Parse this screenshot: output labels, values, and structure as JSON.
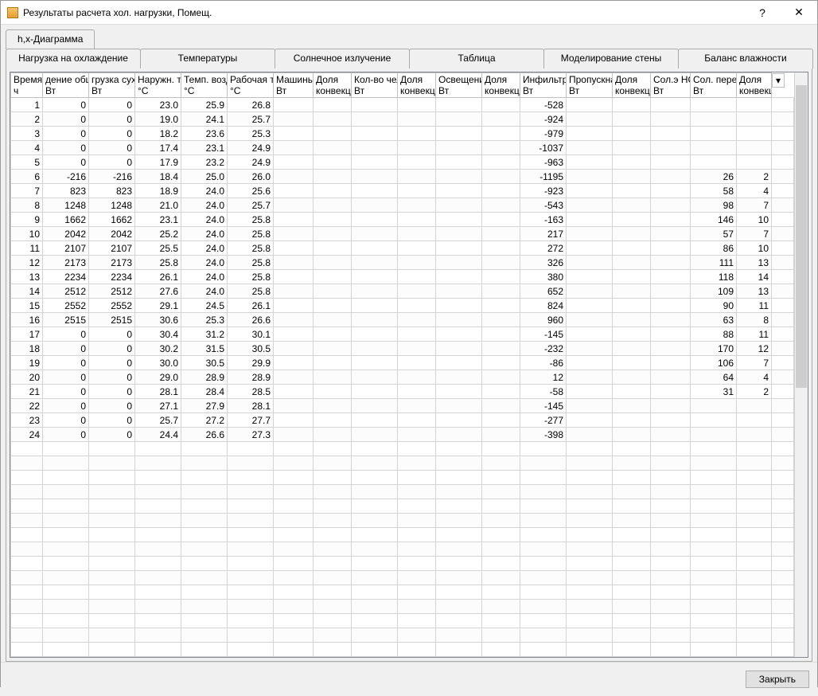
{
  "title": "Результаты расчета хол. нагрузки, Помещ.",
  "help": "?",
  "close": "✕",
  "tab_diagram": "h,x-Диаграмма",
  "tabs": [
    "Нагрузка на охлаждение",
    "Температуры",
    "Солнечное излучение",
    "Таблица",
    "Моделирование стены",
    "Баланс влажности"
  ],
  "columns": [
    {
      "h1": "Время",
      "h2": "ч"
    },
    {
      "h1": "дение общ.",
      "h2": "Вт"
    },
    {
      "h1": "грузка сух.",
      "h2": "Вт"
    },
    {
      "h1": "Наружн. те",
      "h2": "°C"
    },
    {
      "h1": "Темп. возд",
      "h2": "°C"
    },
    {
      "h1": "Рабочая те",
      "h2": "°C"
    },
    {
      "h1": "Машины",
      "h2": "Вт"
    },
    {
      "h1": "Доля",
      "h2": "конвекц"
    },
    {
      "h1": "Кол-во чел.",
      "h2": "Вт"
    },
    {
      "h1": "Доля",
      "h2": "конвекц"
    },
    {
      "h1": "Освещение",
      "h2": "Вт"
    },
    {
      "h1": "Доля",
      "h2": "конвекц"
    },
    {
      "h1": "Инфильтра",
      "h2": "Вт"
    },
    {
      "h1": "Пропускна",
      "h2": "Вт"
    },
    {
      "h1": "Доля",
      "h2": "конвекц"
    },
    {
      "h1": "Сол.э НС",
      "h2": "Вт"
    },
    {
      "h1": "Сол. перед",
      "h2": "Вт"
    },
    {
      "h1": "Доля",
      "h2": "конвекц"
    }
  ],
  "rows": [
    [
      "1",
      "0",
      "0",
      "23.0",
      "25.9",
      "26.8",
      "",
      "",
      "",
      "",
      "",
      "",
      "-528",
      "",
      "",
      "",
      "",
      ""
    ],
    [
      "2",
      "0",
      "0",
      "19.0",
      "24.1",
      "25.7",
      "",
      "",
      "",
      "",
      "",
      "",
      "-924",
      "",
      "",
      "",
      "",
      ""
    ],
    [
      "3",
      "0",
      "0",
      "18.2",
      "23.6",
      "25.3",
      "",
      "",
      "",
      "",
      "",
      "",
      "-979",
      "",
      "",
      "",
      "",
      ""
    ],
    [
      "4",
      "0",
      "0",
      "17.4",
      "23.1",
      "24.9",
      "",
      "",
      "",
      "",
      "",
      "",
      "-1037",
      "",
      "",
      "",
      "",
      ""
    ],
    [
      "5",
      "0",
      "0",
      "17.9",
      "23.2",
      "24.9",
      "",
      "",
      "",
      "",
      "",
      "",
      "-963",
      "",
      "",
      "",
      "",
      ""
    ],
    [
      "6",
      "-216",
      "-216",
      "18.4",
      "25.0",
      "26.0",
      "",
      "",
      "",
      "",
      "",
      "",
      "-1195",
      "",
      "",
      "",
      "26",
      "2"
    ],
    [
      "7",
      "823",
      "823",
      "18.9",
      "24.0",
      "25.6",
      "",
      "",
      "",
      "",
      "",
      "",
      "-923",
      "",
      "",
      "",
      "58",
      "4"
    ],
    [
      "8",
      "1248",
      "1248",
      "21.0",
      "24.0",
      "25.7",
      "",
      "",
      "",
      "",
      "",
      "",
      "-543",
      "",
      "",
      "",
      "98",
      "7"
    ],
    [
      "9",
      "1662",
      "1662",
      "23.1",
      "24.0",
      "25.8",
      "",
      "",
      "",
      "",
      "",
      "",
      "-163",
      "",
      "",
      "",
      "146",
      "10"
    ],
    [
      "10",
      "2042",
      "2042",
      "25.2",
      "24.0",
      "25.8",
      "",
      "",
      "",
      "",
      "",
      "",
      "217",
      "",
      "",
      "",
      "57",
      "7"
    ],
    [
      "11",
      "2107",
      "2107",
      "25.5",
      "24.0",
      "25.8",
      "",
      "",
      "",
      "",
      "",
      "",
      "272",
      "",
      "",
      "",
      "86",
      "10"
    ],
    [
      "12",
      "2173",
      "2173",
      "25.8",
      "24.0",
      "25.8",
      "",
      "",
      "",
      "",
      "",
      "",
      "326",
      "",
      "",
      "",
      "111",
      "13"
    ],
    [
      "13",
      "2234",
      "2234",
      "26.1",
      "24.0",
      "25.8",
      "",
      "",
      "",
      "",
      "",
      "",
      "380",
      "",
      "",
      "",
      "118",
      "14"
    ],
    [
      "14",
      "2512",
      "2512",
      "27.6",
      "24.0",
      "25.8",
      "",
      "",
      "",
      "",
      "",
      "",
      "652",
      "",
      "",
      "",
      "109",
      "13"
    ],
    [
      "15",
      "2552",
      "2552",
      "29.1",
      "24.5",
      "26.1",
      "",
      "",
      "",
      "",
      "",
      "",
      "824",
      "",
      "",
      "",
      "90",
      "11"
    ],
    [
      "16",
      "2515",
      "2515",
      "30.6",
      "25.3",
      "26.6",
      "",
      "",
      "",
      "",
      "",
      "",
      "960",
      "",
      "",
      "",
      "63",
      "8"
    ],
    [
      "17",
      "0",
      "0",
      "30.4",
      "31.2",
      "30.1",
      "",
      "",
      "",
      "",
      "",
      "",
      "-145",
      "",
      "",
      "",
      "88",
      "11"
    ],
    [
      "18",
      "0",
      "0",
      "30.2",
      "31.5",
      "30.5",
      "",
      "",
      "",
      "",
      "",
      "",
      "-232",
      "",
      "",
      "",
      "170",
      "12"
    ],
    [
      "19",
      "0",
      "0",
      "30.0",
      "30.5",
      "29.9",
      "",
      "",
      "",
      "",
      "",
      "",
      "-86",
      "",
      "",
      "",
      "106",
      "7"
    ],
    [
      "20",
      "0",
      "0",
      "29.0",
      "28.9",
      "28.9",
      "",
      "",
      "",
      "",
      "",
      "",
      "12",
      "",
      "",
      "",
      "64",
      "4"
    ],
    [
      "21",
      "0",
      "0",
      "28.1",
      "28.4",
      "28.5",
      "",
      "",
      "",
      "",
      "",
      "",
      "-58",
      "",
      "",
      "",
      "31",
      "2"
    ],
    [
      "22",
      "0",
      "0",
      "27.1",
      "27.9",
      "28.1",
      "",
      "",
      "",
      "",
      "",
      "",
      "-145",
      "",
      "",
      "",
      "",
      ""
    ],
    [
      "23",
      "0",
      "0",
      "25.7",
      "27.2",
      "27.7",
      "",
      "",
      "",
      "",
      "",
      "",
      "-277",
      "",
      "",
      "",
      "",
      ""
    ],
    [
      "24",
      "0",
      "0",
      "24.4",
      "26.6",
      "27.3",
      "",
      "",
      "",
      "",
      "",
      "",
      "-398",
      "",
      "",
      "",
      "",
      ""
    ]
  ],
  "empty_rows": 15,
  "close_btn": "Закрыть"
}
